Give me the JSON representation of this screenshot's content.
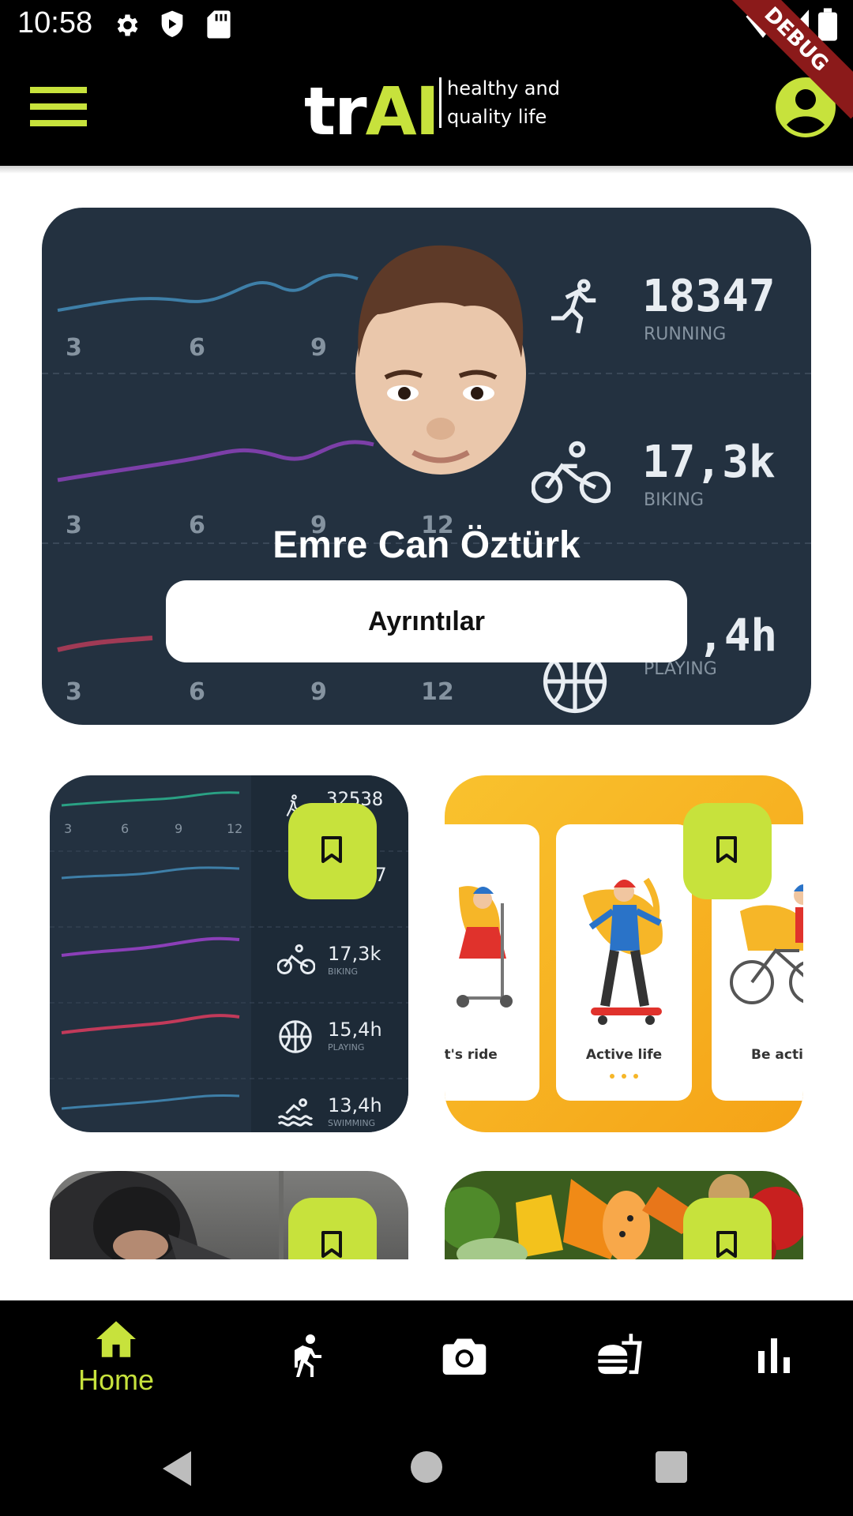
{
  "status_bar": {
    "time": "10:58",
    "icons": [
      "gear-icon",
      "shield-icon",
      "sdcard-icon",
      "wifi-icon",
      "signal-icon",
      "battery-icon"
    ],
    "debug_banner": "DEBUG"
  },
  "app_bar": {
    "logo_prefix": "tr",
    "logo_accent": "AI",
    "tagline_line1": "healthy and",
    "tagline_line2": "quality life",
    "menu_icon": "menu-icon",
    "profile_icon": "account-circle-icon"
  },
  "hero": {
    "user_name": "Emre Can Öztürk",
    "details_button": "Ayrıntılar",
    "stats": [
      {
        "value": "18347",
        "label": "RUNNING"
      },
      {
        "value": "17,3k",
        "label": "BIKING"
      },
      {
        "value": ",4h",
        "label": "PLAYING"
      }
    ],
    "ticks_row1": [
      "3",
      "6",
      "9"
    ],
    "ticks_row2": [
      "3",
      "6",
      "9",
      "12"
    ],
    "ticks_row3": [
      "3",
      "6",
      "9",
      "12"
    ]
  },
  "tiles": {
    "stats_tile": {
      "ticks": [
        "3",
        "6",
        "9",
        "12"
      ],
      "stats": [
        {
          "value": "32538",
          "label": ""
        },
        {
          "value": "7",
          "label": ""
        },
        {
          "value": "17,3k",
          "label": "BIKING"
        },
        {
          "value": "15,4h",
          "label": "PLAYING"
        },
        {
          "value": "13,4h",
          "label": "SWIMMING"
        }
      ]
    },
    "onboarding_tile": {
      "cards": [
        "et's ride",
        "Active life",
        "Be activ"
      ]
    }
  },
  "bottom_nav": {
    "home_label": "Home",
    "items": [
      "home-icon",
      "run-icon",
      "camera-icon",
      "fastfood-icon",
      "bar-chart-icon"
    ]
  },
  "colors": {
    "accent": "#c7e23c",
    "hero_bg": "#233140",
    "onboarding_bg": "#f7b11f"
  }
}
